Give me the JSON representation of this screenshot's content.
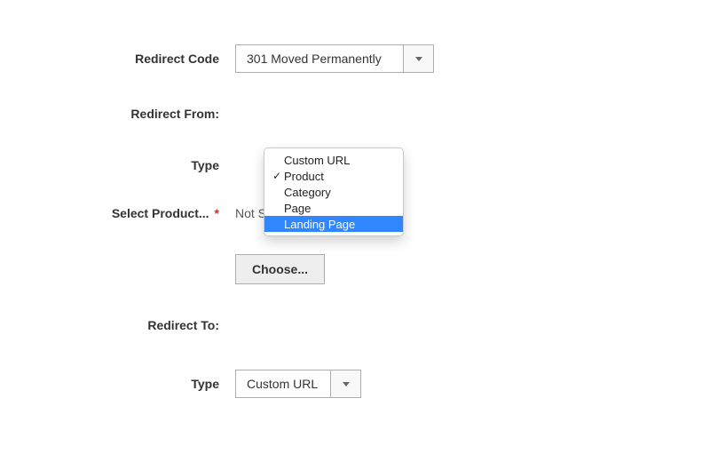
{
  "redirectCode": {
    "label": "Redirect Code",
    "value": "301 Moved Permanently"
  },
  "redirectFrom": {
    "label": "Redirect From:"
  },
  "fromType": {
    "label": "Type",
    "options": [
      {
        "label": "Custom URL"
      },
      {
        "label": "Product",
        "checked": true
      },
      {
        "label": "Category"
      },
      {
        "label": "Page"
      },
      {
        "label": "Landing Page",
        "highlight": true
      }
    ]
  },
  "selectProduct": {
    "label": "Select Product...",
    "value": "Not Selected"
  },
  "chooseButton": {
    "label": "Choose..."
  },
  "redirectTo": {
    "label": "Redirect To:"
  },
  "toType": {
    "label": "Type",
    "value": "Custom URL"
  }
}
